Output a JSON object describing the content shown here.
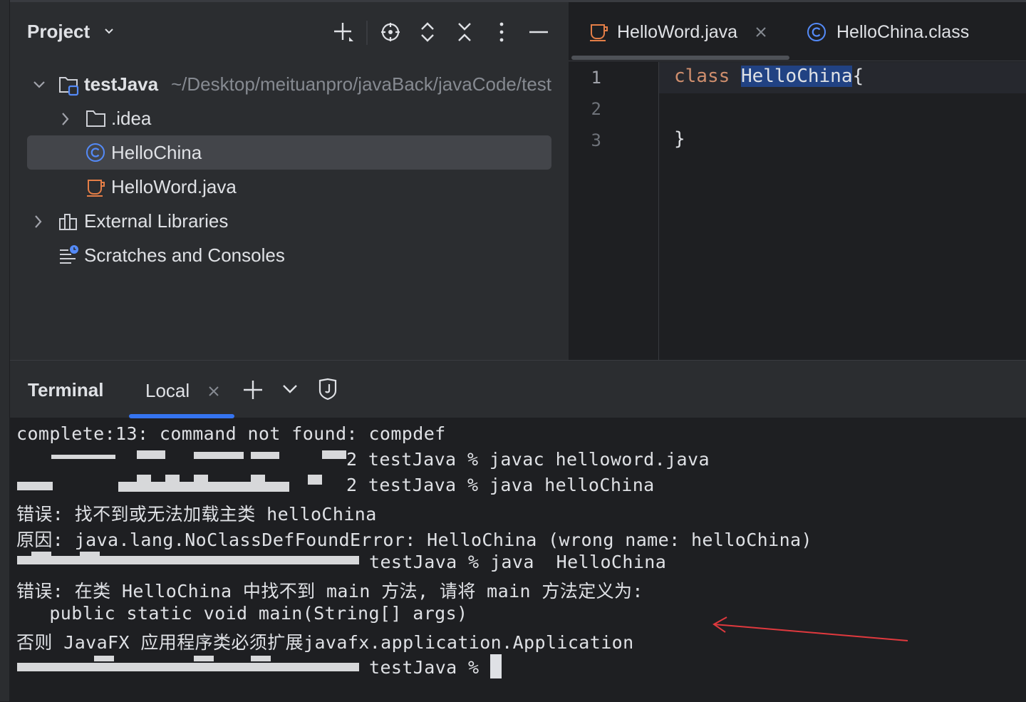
{
  "project_panel": {
    "title": "Project",
    "tree": [
      {
        "label": "testJava",
        "path": "~/Desktop/meituanpro/javaBack/javaCode/test",
        "icon": "module-folder-icon",
        "expanded": true
      },
      {
        "label": ".idea",
        "icon": "folder-icon",
        "expanded": false
      },
      {
        "label": "HelloChina",
        "icon": "class-icon",
        "selected": true
      },
      {
        "label": "HelloWord.java",
        "icon": "java-file-icon"
      },
      {
        "label": "External Libraries",
        "icon": "libraries-icon",
        "expanded": false
      },
      {
        "label": "Scratches and Consoles",
        "icon": "scratches-icon"
      }
    ]
  },
  "editor": {
    "tabs": [
      {
        "label": "HelloWord.java",
        "icon": "java-file-icon",
        "active": true
      },
      {
        "label": "HelloChina.class",
        "icon": "class-icon",
        "active": false
      }
    ],
    "line_numbers": [
      "1",
      "2",
      "3"
    ],
    "code": {
      "keyword": "class",
      "class_name": "HelloChina",
      "open_brace": "{",
      "close_brace": "}"
    }
  },
  "terminal": {
    "title": "Terminal",
    "tab_label": "Local",
    "lines": [
      "complete:13: command not found: compdef",
      "2 testJava % javac helloword.java",
      "2 testJava % java helloChina",
      "错误: 找不到或无法加载主类 helloChina",
      "原因: java.lang.NoClassDefFoundError: HelloChina (wrong name: helloChina)",
      "testJava % java  HelloChina",
      "错误: 在类 HelloChina 中找不到 main 方法, 请将 main 方法定义为:",
      "   public static void main(String[] args)",
      "否则 JavaFX 应用程序类必须扩展javafx.application.Application",
      "testJava % "
    ]
  },
  "colors": {
    "panel_bg": "#2b2d30",
    "editor_bg": "#1e1f22",
    "keyword": "#cf8e6d",
    "selection": "#214283",
    "accent_blue": "#3574f0",
    "java_icon": "#e47e47",
    "class_icon": "#548af7",
    "annotation_arrow": "#e0393e"
  }
}
